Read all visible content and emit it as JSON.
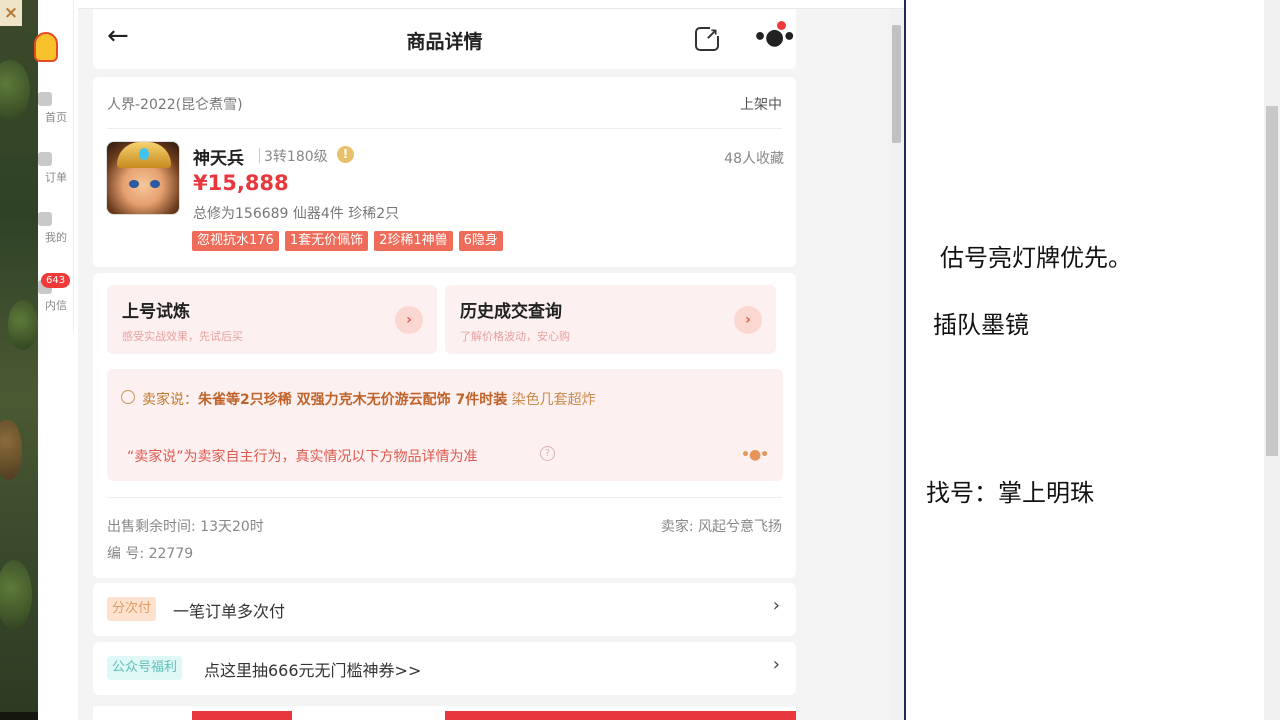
{
  "game_window": {
    "close_label": "×"
  },
  "app_sidebar": {
    "items": [
      {
        "label": "首页"
      },
      {
        "label": "订单"
      },
      {
        "label": "我的"
      },
      {
        "label": "内信"
      }
    ],
    "msg_badge": "643"
  },
  "nav": {
    "back_icon": "arrow-left-icon",
    "title": "商品详情",
    "share_icon": "share-icon",
    "more_icon": "more-icon"
  },
  "product": {
    "server": "人界-2022(昆仑煮雪)",
    "status": "上架中",
    "name": "神天兵",
    "level": "3转180级",
    "favorites": "48人收藏",
    "price": "¥15,888",
    "stats": "总修为156689  仙器4件  珍稀2只",
    "tags": [
      "忽视抗水176",
      "1套无价佩饰",
      "2珍稀1神兽",
      "6隐身"
    ]
  },
  "actions": [
    {
      "title": "上号试炼",
      "subtitle": "感受实战效果，先试后买",
      "arrow": "›"
    },
    {
      "title": "历史成交查询",
      "subtitle": "了解价格波动，安心购",
      "arrow": "›"
    }
  ],
  "seller_says": {
    "prefix": "卖家说：",
    "highlight": "朱雀等2只珍稀 双强力克木无价游云配饰 7件时装",
    "plain": " 染色几套超炸",
    "disclaimer": "“卖家说”为卖家自主行为，真实情况以下方物品详情为准",
    "help": "?",
    "dots": "•●•"
  },
  "meta": {
    "remaining": "出售剩余时间: 13天20时",
    "seller": "卖家: 风起兮意飞扬",
    "serial": "编 号: 22779"
  },
  "rows": [
    {
      "pill": "分次付",
      "text": "一笔订单多次付",
      "chevron": "›"
    },
    {
      "pill": "公众号福利",
      "text": "点这里抽666元无门槛神券>>",
      "chevron": "›"
    }
  ],
  "notes": [
    "估号亮灯牌优先。",
    "插队墨镜",
    "找号：掌上明珠"
  ],
  "colors": {
    "accent_red": "#e8383d",
    "tag_red": "#ef6b5a",
    "soft_pink": "#fdf0f0",
    "seller_brown": "#c0632a"
  }
}
